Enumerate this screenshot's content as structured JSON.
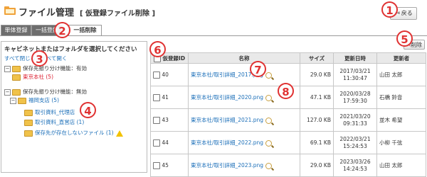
{
  "header": {
    "title": "ファイル管理",
    "subtitle": "[ 仮登録ファイル削除 ]",
    "back_label": "戻る"
  },
  "tabs": [
    {
      "label": "単体登録",
      "active": false
    },
    {
      "label": "一括登録",
      "active": false
    },
    {
      "label": "一括削除",
      "active": true
    }
  ],
  "cabinet": {
    "heading": "キャビネットまたはフォルダを選択してください",
    "expand_collapse": "すべて閉じる／すべて開く",
    "tree": [
      {
        "label": "保存先振り分け機能：有効",
        "level": 0,
        "toggle": "−"
      },
      {
        "label": "東京本社 (5)",
        "level": 1,
        "color": "red"
      },
      {
        "label": "保存先振り分け機能：無効",
        "level": 0,
        "toggle": "−"
      },
      {
        "label": "福岡支店 (5)",
        "level": 1,
        "toggle": "−",
        "color": "blue"
      },
      {
        "label": "取引資料_代理店",
        "level": 2,
        "color": "blue"
      },
      {
        "label": "取引資料_直営店 (1)",
        "level": 2,
        "color": "blue"
      },
      {
        "label": "保存先が存在しないファイル (1)",
        "level": 2,
        "color": "blue",
        "warning": true
      }
    ]
  },
  "toolbar": {
    "delete_label": "削除"
  },
  "table": {
    "columns": [
      "仮登録ID",
      "名称",
      "サイズ",
      "更新日時",
      "更新者"
    ],
    "rows": [
      {
        "id": "40",
        "name": "東京本社/取引詳細_2017.png",
        "size": "29.0 KB",
        "date": "2017/03/21",
        "time": "11:30:47",
        "user": "山田 太郎"
      },
      {
        "id": "41",
        "name": "東京本社/取引詳細_2020.png",
        "size": "47.1 KB",
        "date": "2020/03/28",
        "time": "17:59:30",
        "user": "石橋 鈴音"
      },
      {
        "id": "43",
        "name": "東京本社/取引詳細_2021.png",
        "size": "127.0 KB",
        "date": "2021/03/20",
        "time": "09:31:33",
        "user": "並木 希望"
      },
      {
        "id": "44",
        "name": "東京本社/取引詳細_2022.png",
        "size": "69.1 KB",
        "date": "2022/03/21",
        "time": "15:24:53",
        "user": "小柳 千弦"
      },
      {
        "id": "45",
        "name": "東京本社/取引詳細_2023.png",
        "size": "29.0 KB",
        "date": "2023/03/26",
        "time": "14:24:53",
        "user": "山田 太郎"
      }
    ]
  },
  "callouts": [
    "1",
    "2",
    "3",
    "4",
    "5",
    "6",
    "7",
    "8"
  ],
  "colors": {
    "link": "#1a6eb8",
    "highlight": "#d23",
    "callout": "#e03232",
    "tab_inactive": "#6d6d6d",
    "folder": "#f0c24a"
  }
}
